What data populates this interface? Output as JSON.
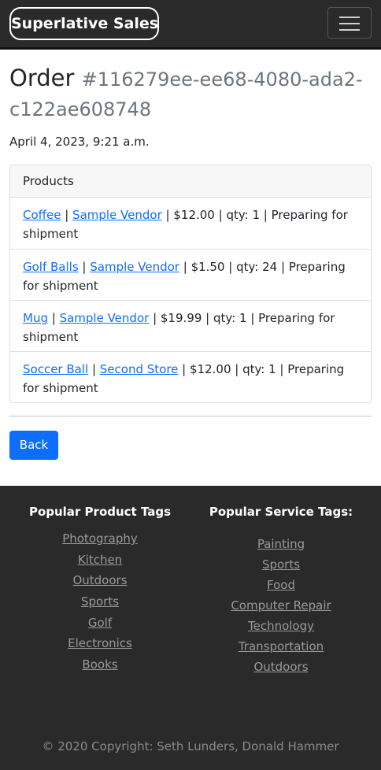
{
  "navbar": {
    "brand": "Superlative Sales",
    "toggle_icon": "hamburger-menu-icon"
  },
  "order": {
    "heading": "Order",
    "id": "#116279ee-ee68-4080-ada2-c122ae608748",
    "date": "April 4, 2023, 9:21 a.m."
  },
  "products": {
    "header": "Products",
    "items": [
      {
        "name": "Coffee",
        "vendor": "Sample Vendor",
        "price": "$12.00",
        "qty": "qty: 1",
        "status": "Preparing for shipment"
      },
      {
        "name": "Golf Balls",
        "vendor": "Sample Vendor",
        "price": "$1.50",
        "qty": "qty: 24",
        "status": "Preparing for shipment"
      },
      {
        "name": "Mug",
        "vendor": "Sample Vendor",
        "price": "$19.99",
        "qty": "qty: 1",
        "status": "Preparing for shipment"
      },
      {
        "name": "Soccer Ball",
        "vendor": "Second Store",
        "price": "$12.00",
        "qty": "qty: 1",
        "status": "Preparing for shipment"
      }
    ]
  },
  "back_button": "Back",
  "footer": {
    "product_tags_title": "Popular Product Tags",
    "product_tags": [
      "Photography",
      "Kitchen",
      "Outdoors",
      "Sports",
      "Golf",
      "Electronics",
      "Books"
    ],
    "service_tags_title": "Popular Service Tags:",
    "service_tags": [
      "Painting",
      "Sports",
      "Food",
      "Computer Repair",
      "Technology",
      "Transportation",
      "Outdoors"
    ],
    "copyright": "© 2020 Copyright: Seth Lunders, Donald Hammer"
  },
  "colors": {
    "navbar_bg": "#2a2a2a",
    "link": "#0d6efd",
    "button": "#0d6efd",
    "footer_bg": "#2a2a2a",
    "muted": "#6c757d"
  }
}
